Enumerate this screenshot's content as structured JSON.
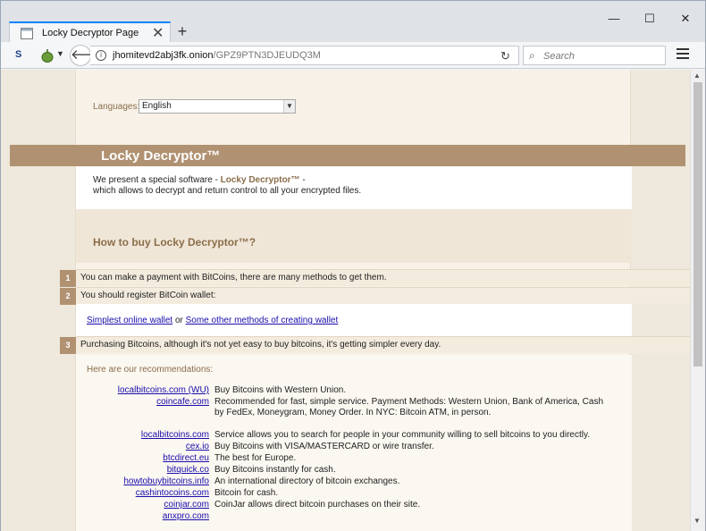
{
  "browser": {
    "tab_title": "Locky Decryptor Page",
    "tab_close": "✕",
    "new_tab": "+",
    "minimize": "—",
    "maximize": "☐",
    "close": "✕",
    "logo_text": "S",
    "url_host": "jhomitevd2abj3fk.onion",
    "url_path": "/GPZ9PTN3DJEUDQ3M",
    "search_placeholder": "Search"
  },
  "page": {
    "languages_label": "Languages:",
    "language_selected": "English",
    "banner_title": "Locky Decryptor™",
    "intro_prefix": "We present a special software - ",
    "intro_highlight": "Locky Decryptor™",
    "intro_suffix": " -",
    "intro_line2": "which allows to decrypt and return control to all your encrypted files.",
    "howto_title": "How to buy Locky Decryptor™?",
    "steps": [
      {
        "num": "1",
        "text": "You can make a payment with BitCoins, there are many methods to get them."
      },
      {
        "num": "2",
        "text": "You should register BitCoin wallet:"
      },
      {
        "num": "3",
        "text": "Purchasing Bitcoins, although it's not yet easy to buy bitcoins, it's getting simpler every day."
      }
    ],
    "wallet_link1": "Simplest online wallet",
    "wallet_or": " or ",
    "wallet_link2": "Some other methods of creating wallet",
    "rec_title": "Here are our recommendations:",
    "recommendations": [
      {
        "name": "localbitcoins.com (WU)",
        "desc": "Buy Bitcoins with Western Union."
      },
      {
        "name": "coincafe.com",
        "desc": "Recommended for fast, simple service. Payment Methods: Western Union, Bank of America, Cash by FedEx, Moneygram, Money Order. In NYC: Bitcoin ATM, in person."
      },
      {
        "name": "localbitcoins.com",
        "desc": "Service allows you to search for people in your community willing to sell bitcoins to you directly."
      },
      {
        "name": "cex.io",
        "desc": "Buy Bitcoins with VISA/MASTERCARD or wire transfer."
      },
      {
        "name": "btcdirect.eu",
        "desc": "The best for Europe."
      },
      {
        "name": "bitquick.co",
        "desc": "Buy Bitcoins instantly for cash."
      },
      {
        "name": "howtobuybitcoins.info",
        "desc": "An international directory of bitcoin exchanges."
      },
      {
        "name": "cashintocoins.com",
        "desc": "Bitcoin for cash."
      },
      {
        "name": "coinjar.com",
        "desc": "CoinJar allows direct bitcoin purchases on their site."
      },
      {
        "name": "anxpro.com",
        "desc": ""
      }
    ]
  },
  "colors": {
    "accent": "#b09272",
    "heading": "#8b6e4a",
    "link": "#1a0dab"
  }
}
